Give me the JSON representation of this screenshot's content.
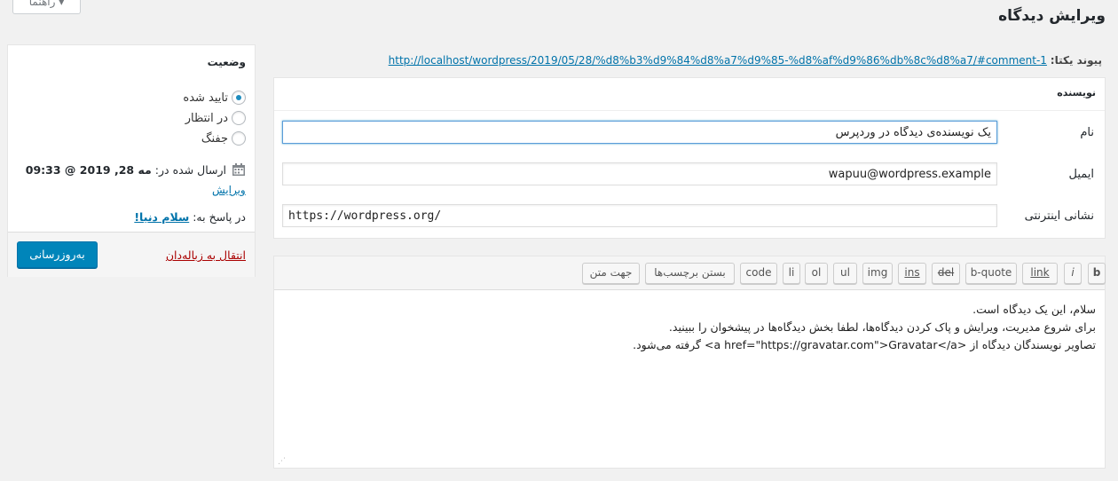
{
  "help_tab": "راهنما ▾",
  "page_title": "ویرایش دیدگاه",
  "permalink": {
    "label": "پیوند یکتا:",
    "url": "http://localhost/wordpress/2019/05/28/%d8%b3%d9%84%d8%a7%d9%85-%d8%af%d9%86%db%8c%d8%a7/#comment-1"
  },
  "author": {
    "heading": "نویسنده",
    "name_label": "نام",
    "name_value": "یک نویسنده‌ی دیدگاه در وردپرس",
    "email_label": "ایمیل",
    "email_value": "wapuu@wordpress.example",
    "url_label": "نشانی اینترنتی",
    "url_value": "https://wordpress.org/"
  },
  "toolbar": {
    "buttons": [
      "b",
      "i",
      "link",
      "b-quote",
      "del",
      "ins",
      "img",
      "ul",
      "ol",
      "li",
      "code",
      "بستن برچسب‌ها",
      "جهت متن"
    ]
  },
  "comment": {
    "line1": "سلام، این یک دیدگاه است.",
    "line2": "برای شروع مدیریت، ویرایش و پاک کردن دیدگاه‌ها، لطفا بخش دیدگاه‌ها در پیشخوان را ببینید.",
    "line3": "تصاویر نویسندگان دیدگاه از <a href=\"https://gravatar.com\">Gravatar</a> گرفته می‌شود."
  },
  "status": {
    "title": "وضعیت",
    "options": [
      "تایید شده",
      "در انتظار",
      "جفنگ"
    ],
    "selected": "تایید شده",
    "sent_label": "ارسال شده در:",
    "sent_date": "مه 28, 2019 @ 09:33",
    "edit_label": "ویرایش",
    "reply_label": "در پاسخ به:",
    "reply_link": "سلام دنیا!",
    "trash_label": "انتقال به زباله‌دان",
    "update_label": "به‌روزرسانی"
  },
  "colors": {
    "accent": "#0085ba",
    "link": "#0073aa",
    "danger": "#a00000"
  }
}
